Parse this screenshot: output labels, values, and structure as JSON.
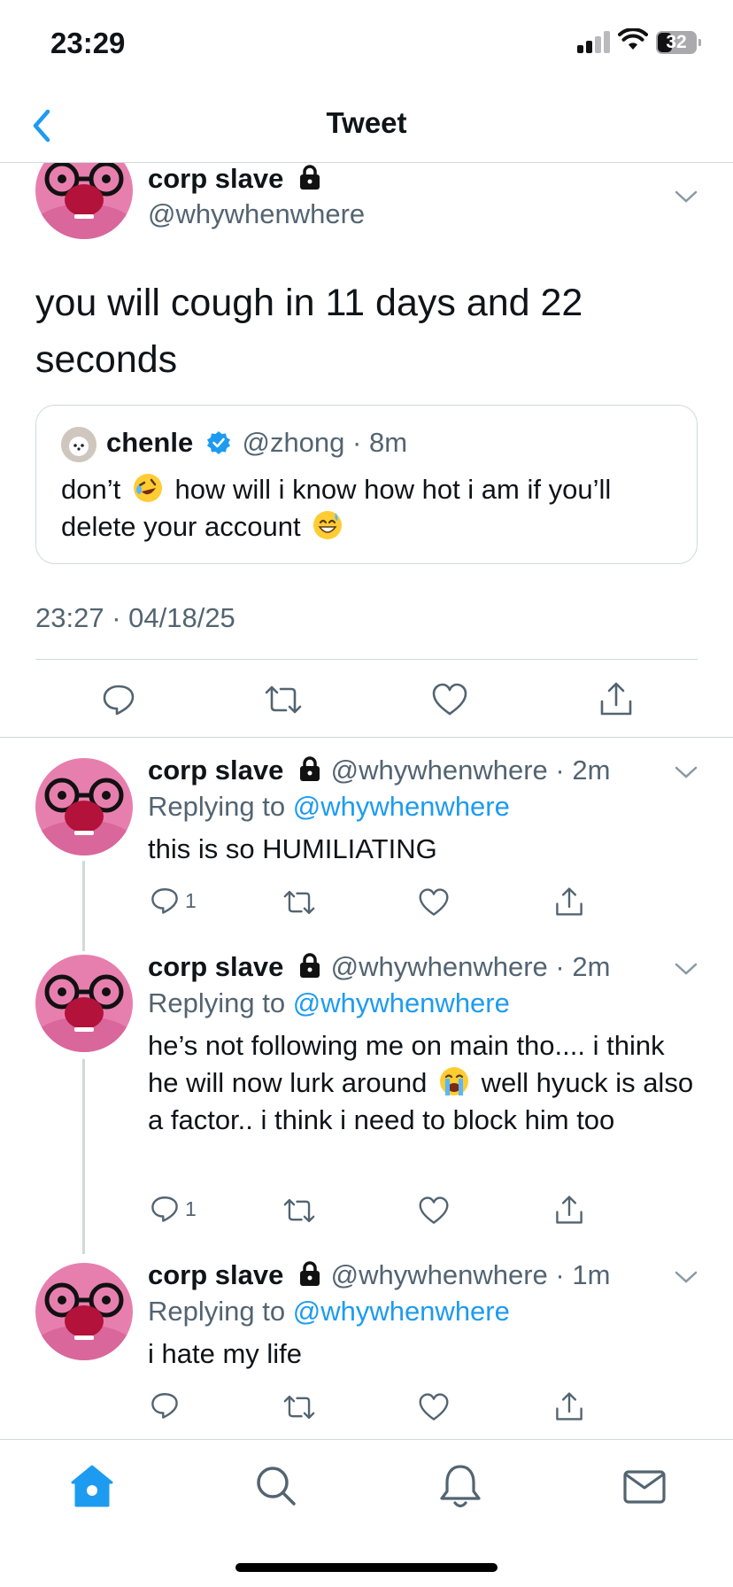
{
  "status_bar": {
    "time": "23:29",
    "battery": "32"
  },
  "nav": {
    "title": "Tweet"
  },
  "main_tweet": {
    "name": "corp slave",
    "handle": "@whywhenwhere",
    "text": "you will cough in 11 days and 22 seconds",
    "quote": {
      "name": "chenle",
      "handle": "@zhong",
      "time": "8m",
      "text_part1": "don’t",
      "emoji1": "rolling-on-floor-laughing-emoji",
      "text_part2": "how will i know how hot i am if you’ll delete your account",
      "emoji2": "grinning-sweat-emoji"
    },
    "timestamp": "23:27 · 04/18/25"
  },
  "replies": [
    {
      "name": "corp slave",
      "handle": "@whywhenwhere",
      "time": "2m",
      "replying_to_label": "Replying to",
      "replying_to": "@whywhenwhere",
      "text": "this is so HUMILIATING",
      "reply_count": "1"
    },
    {
      "name": "corp slave",
      "handle": "@whywhenwhere",
      "time": "2m",
      "replying_to_label": "Replying to",
      "replying_to": "@whywhenwhere",
      "text_part1": "he’s not following me on main tho.... i think he will now lurk around",
      "emoji": "loudly-crying-emoji",
      "text_part2": "well hyuck is also a factor.. i think i need to block him too",
      "reply_count": "1"
    },
    {
      "name": "corp slave",
      "handle": "@whywhenwhere",
      "time": "1m",
      "replying_to_label": "Replying to",
      "replying_to": "@whywhenwhere",
      "text": "i hate my life",
      "reply_count": ""
    }
  ],
  "colors": {
    "accent": "#1d9bf0",
    "muted": "#536471",
    "border": "#cfd9de"
  }
}
